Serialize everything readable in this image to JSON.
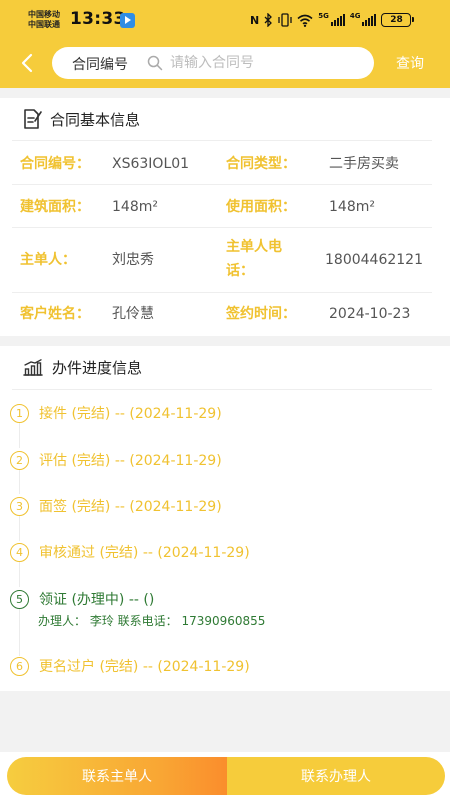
{
  "status_bar": {
    "carrier_1": "中国移动",
    "carrier_2": "中国联通",
    "time": "13:33",
    "signal_1_label": "5G",
    "signal_2_label": "4G",
    "battery": "28"
  },
  "header": {
    "search_label": "合同编号",
    "search_placeholder": "请输入合同号",
    "query_button": "查询"
  },
  "basic_info": {
    "title": "合同基本信息",
    "fields": {
      "contract_no": {
        "label": "合同编号：",
        "value": "XS63IOL01"
      },
      "contract_type": {
        "label": "合同类型：",
        "value": "二手房买卖"
      },
      "building_area": {
        "label": "建筑面积：",
        "value": "148m²"
      },
      "usable_area": {
        "label": "使用面积：",
        "value": "148m²"
      },
      "owner": {
        "label": "主单人：",
        "value": "刘忠秀"
      },
      "owner_phone": {
        "label_1": "主单人电",
        "label_2": "话：",
        "value": "18004462121"
      },
      "customer": {
        "label": "客户姓名：",
        "value": "孔伶慧"
      },
      "sign_date": {
        "label": "签约时间：",
        "value": "2024-10-23"
      }
    }
  },
  "progress": {
    "title": "办件进度信息",
    "steps": [
      {
        "num": "1",
        "text": "接件 (完结) -- (2024-11-29)",
        "active": false
      },
      {
        "num": "2",
        "text": "评估 (完结) -- (2024-11-29)",
        "active": false
      },
      {
        "num": "3",
        "text": "面签 (完结) -- (2024-11-29)",
        "active": false
      },
      {
        "num": "4",
        "text": "审核通过 (完结) -- (2024-11-29)",
        "active": false
      },
      {
        "num": "5",
        "text": "领证 (办理中) -- ()",
        "active": true,
        "sub": "办理人：  李玲  联系电话：  17390960855"
      },
      {
        "num": "6",
        "text": "更名过户 (完结) -- (2024-11-29)",
        "active": false
      }
    ]
  },
  "bottom": {
    "contact_owner": "联系主单人",
    "contact_handler": "联系办理人"
  },
  "colors": {
    "brand_yellow": "#f6cc3b",
    "label_yellow": "#f0c231",
    "active_green": "#2f7a34",
    "orange": "#fa8d2c"
  }
}
